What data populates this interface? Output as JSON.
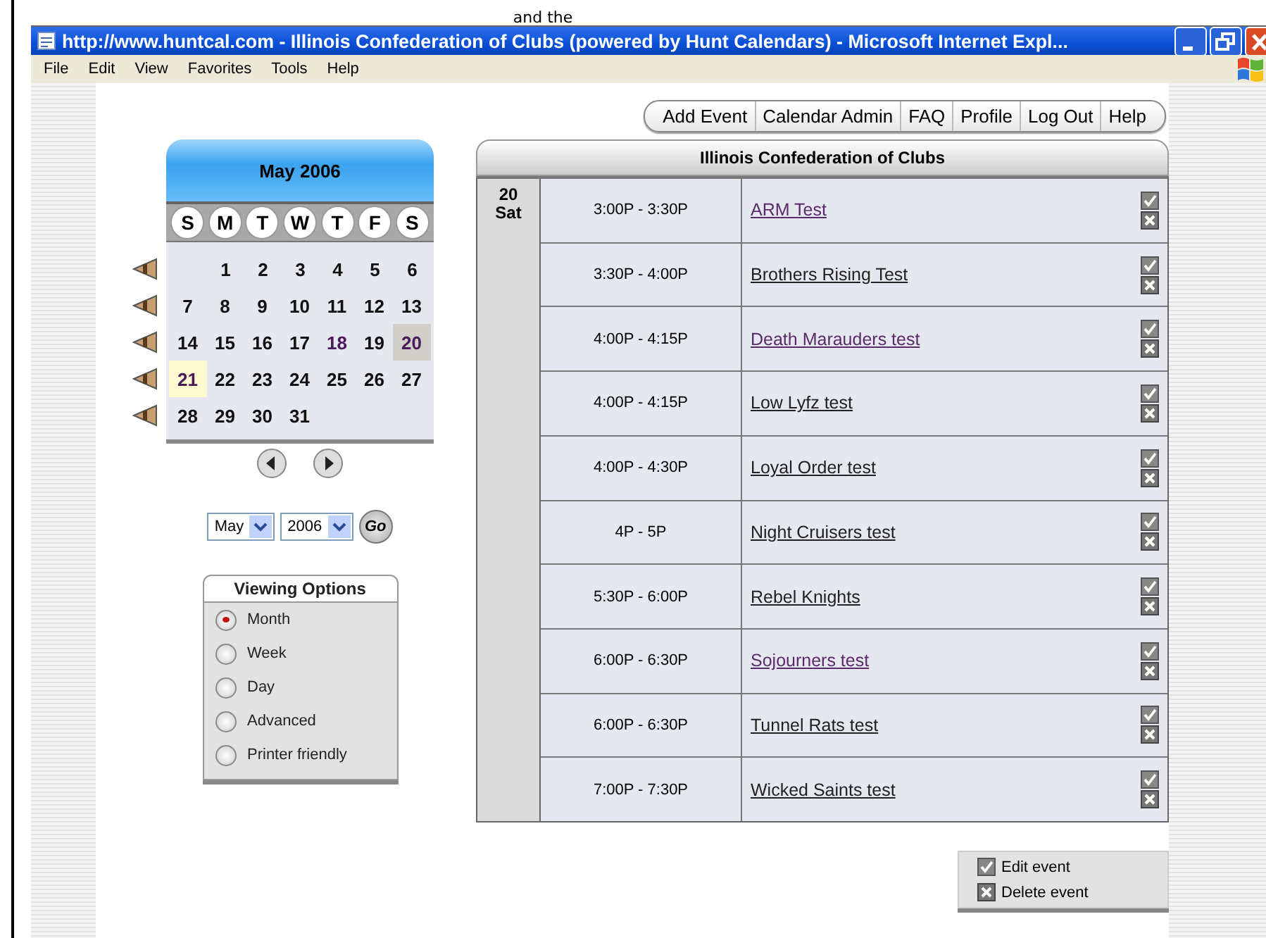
{
  "background_window": {
    "text": "and the"
  },
  "window": {
    "title": "http://www.huntcal.com - Illinois Confederation of Clubs (powered by Hunt Calendars) - Microsoft Internet Expl..."
  },
  "menu": [
    "File",
    "Edit",
    "View",
    "Favorites",
    "Tools",
    "Help"
  ],
  "nav": [
    "Add Event",
    "Calendar Admin",
    "FAQ",
    "Profile",
    "Log Out",
    "Help"
  ],
  "calendar": {
    "title": "May  2006",
    "weekdays": [
      "S",
      "M",
      "T",
      "W",
      "T",
      "F",
      "S"
    ],
    "weeks": [
      [
        {
          "day": "1",
          "selected": false,
          "today": false,
          "events": false
        },
        {
          "day": "2",
          "selected": false,
          "today": false,
          "events": false
        },
        {
          "day": "3",
          "selected": false,
          "today": false,
          "events": false
        },
        {
          "day": "4",
          "selected": false,
          "today": false,
          "events": false
        },
        {
          "day": "5",
          "selected": false,
          "today": false,
          "events": false
        },
        {
          "day": "6",
          "selected": false,
          "today": false,
          "events": false
        }
      ],
      [
        {
          "day": "7",
          "selected": false,
          "today": false,
          "events": false
        },
        {
          "day": "8",
          "selected": false,
          "today": false,
          "events": false
        },
        {
          "day": "9",
          "selected": false,
          "today": false,
          "events": false
        },
        {
          "day": "10",
          "selected": false,
          "today": false,
          "events": false
        },
        {
          "day": "11",
          "selected": false,
          "today": false,
          "events": false
        },
        {
          "day": "12",
          "selected": false,
          "today": false,
          "events": false
        },
        {
          "day": "13",
          "selected": false,
          "today": false,
          "events": false
        }
      ],
      [
        {
          "day": "14",
          "selected": false,
          "today": false,
          "events": false
        },
        {
          "day": "15",
          "selected": false,
          "today": false,
          "events": false
        },
        {
          "day": "16",
          "selected": false,
          "today": false,
          "events": false
        },
        {
          "day": "17",
          "selected": false,
          "today": false,
          "events": false
        },
        {
          "day": "18",
          "selected": false,
          "today": false,
          "events": true
        },
        {
          "day": "19",
          "selected": false,
          "today": false,
          "events": false
        },
        {
          "day": "20",
          "selected": true,
          "today": false,
          "events": true
        }
      ],
      [
        {
          "day": "21",
          "selected": false,
          "today": true,
          "events": true
        },
        {
          "day": "22",
          "selected": false,
          "today": false,
          "events": false
        },
        {
          "day": "23",
          "selected": false,
          "today": false,
          "events": false
        },
        {
          "day": "24",
          "selected": false,
          "today": false,
          "events": false
        },
        {
          "day": "25",
          "selected": false,
          "today": false,
          "events": false
        },
        {
          "day": "26",
          "selected": false,
          "today": false,
          "events": false
        },
        {
          "day": "27",
          "selected": false,
          "today": false,
          "events": false
        }
      ],
      [
        {
          "day": "28",
          "selected": false,
          "today": false,
          "events": false
        },
        {
          "day": "29",
          "selected": false,
          "today": false,
          "events": false
        },
        {
          "day": "30",
          "selected": false,
          "today": false,
          "events": false
        },
        {
          "day": "31",
          "selected": false,
          "today": false,
          "events": false
        }
      ]
    ]
  },
  "month_select": {
    "value": "May"
  },
  "year_select": {
    "value": "2006"
  },
  "go_button": "Go",
  "viewing_options": {
    "title": "Viewing Options",
    "options": [
      {
        "label": "Month",
        "selected": true
      },
      {
        "label": "Week",
        "selected": false
      },
      {
        "label": "Day",
        "selected": false
      },
      {
        "label": "Advanced",
        "selected": false
      },
      {
        "label": "Printer friendly",
        "selected": false
      }
    ]
  },
  "events_table": {
    "title": "Illinois Confederation of Clubs",
    "date": "20",
    "weekday": "Sat",
    "rows": [
      {
        "time": "3:00P - 3:30P",
        "name": "ARM Test",
        "visited": true
      },
      {
        "time": "3:30P - 4:00P",
        "name": "Brothers Rising Test",
        "visited": false
      },
      {
        "time": "4:00P - 4:15P",
        "name": "Death Marauders test",
        "visited": true
      },
      {
        "time": "4:00P - 4:15P",
        "name": "Low Lyfz test",
        "visited": false
      },
      {
        "time": "4:00P - 4:30P",
        "name": "Loyal Order test",
        "visited": false
      },
      {
        "time": "4P - 5P",
        "name": "Night Cruisers test",
        "visited": false
      },
      {
        "time": "5:30P - 6:00P",
        "name": "Rebel Knights",
        "visited": false
      },
      {
        "time": "6:00P - 6:30P",
        "name": "Sojourners test",
        "visited": true
      },
      {
        "time": "6:00P - 6:30P",
        "name": "Tunnel Rats test",
        "visited": false
      },
      {
        "time": "7:00P - 7:30P",
        "name": "Wicked Saints test",
        "visited": false
      }
    ]
  },
  "legend": [
    "Edit event",
    "Delete event"
  ]
}
